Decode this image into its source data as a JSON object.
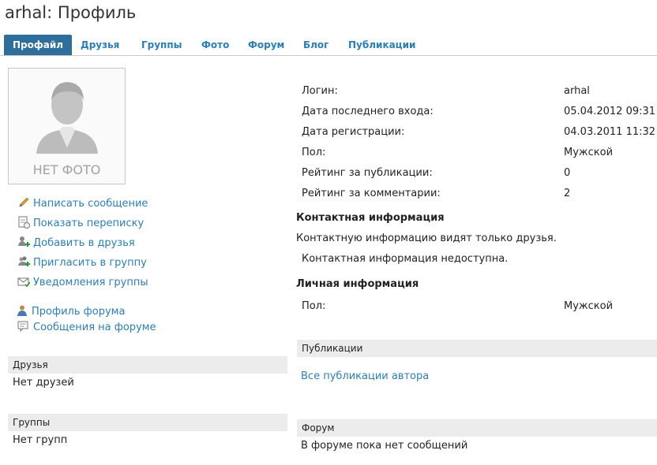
{
  "page": {
    "title": "arhal: Профиль"
  },
  "tabs": [
    {
      "label": "Профайл",
      "active": true
    },
    {
      "label": "Друзья"
    },
    {
      "label": "Группы"
    },
    {
      "label": "Фото"
    },
    {
      "label": "Форум"
    },
    {
      "label": "Блог"
    },
    {
      "label": "Публикации"
    }
  ],
  "photo": {
    "placeholder": "НЕТ ФОТО",
    "icon": "user-silhouette"
  },
  "actions": [
    {
      "label": "Написать сообщение",
      "icon": "pencil-icon"
    },
    {
      "label": "Показать переписку",
      "icon": "correspondence-icon"
    },
    {
      "label": "Добавить в друзья",
      "icon": "add-friend-icon"
    },
    {
      "label": "Пригласить в группу",
      "icon": "invite-group-icon"
    },
    {
      "label": "Уведомления группы",
      "icon": "envelope-icon"
    }
  ],
  "forum_links": [
    {
      "label": "Профиль форума",
      "icon": "forum-profile-icon"
    },
    {
      "label": "Сообщения на форуме",
      "icon": "forum-messages-icon"
    }
  ],
  "friends": {
    "heading": "Друзья",
    "empty": "Нет друзей"
  },
  "groups": {
    "heading": "Группы",
    "empty": "Нет групп"
  },
  "profile": [
    {
      "label": "Логин:",
      "value": "arhal"
    },
    {
      "label": "Дата последнего входа:",
      "value": "05.04.2012 09:31"
    },
    {
      "label": "Дата регистрации:",
      "value": "04.03.2011 11:32"
    },
    {
      "label": "Пол:",
      "value": "Мужской"
    },
    {
      "label": "Рейтинг за публикации:",
      "value": "0"
    },
    {
      "label": "Рейтинг за комментарии:",
      "value": "2"
    }
  ],
  "contact": {
    "heading": "Контактная информация",
    "note": "Контактную информацию видят только друзья.",
    "unavailable": "Контактная информация недоступна."
  },
  "personal": {
    "heading": "Личная информация",
    "rows": [
      {
        "label": "Пол:",
        "value": "Мужской"
      }
    ]
  },
  "publications": {
    "heading": "Публикации",
    "link": "Все публикации автора"
  },
  "forum": {
    "heading": "Форум",
    "empty": "В форуме пока нет сообщений"
  },
  "colors": {
    "link": "#2b7fb4",
    "active_tab": "#2d6e9c",
    "section_bg": "#ececec"
  }
}
